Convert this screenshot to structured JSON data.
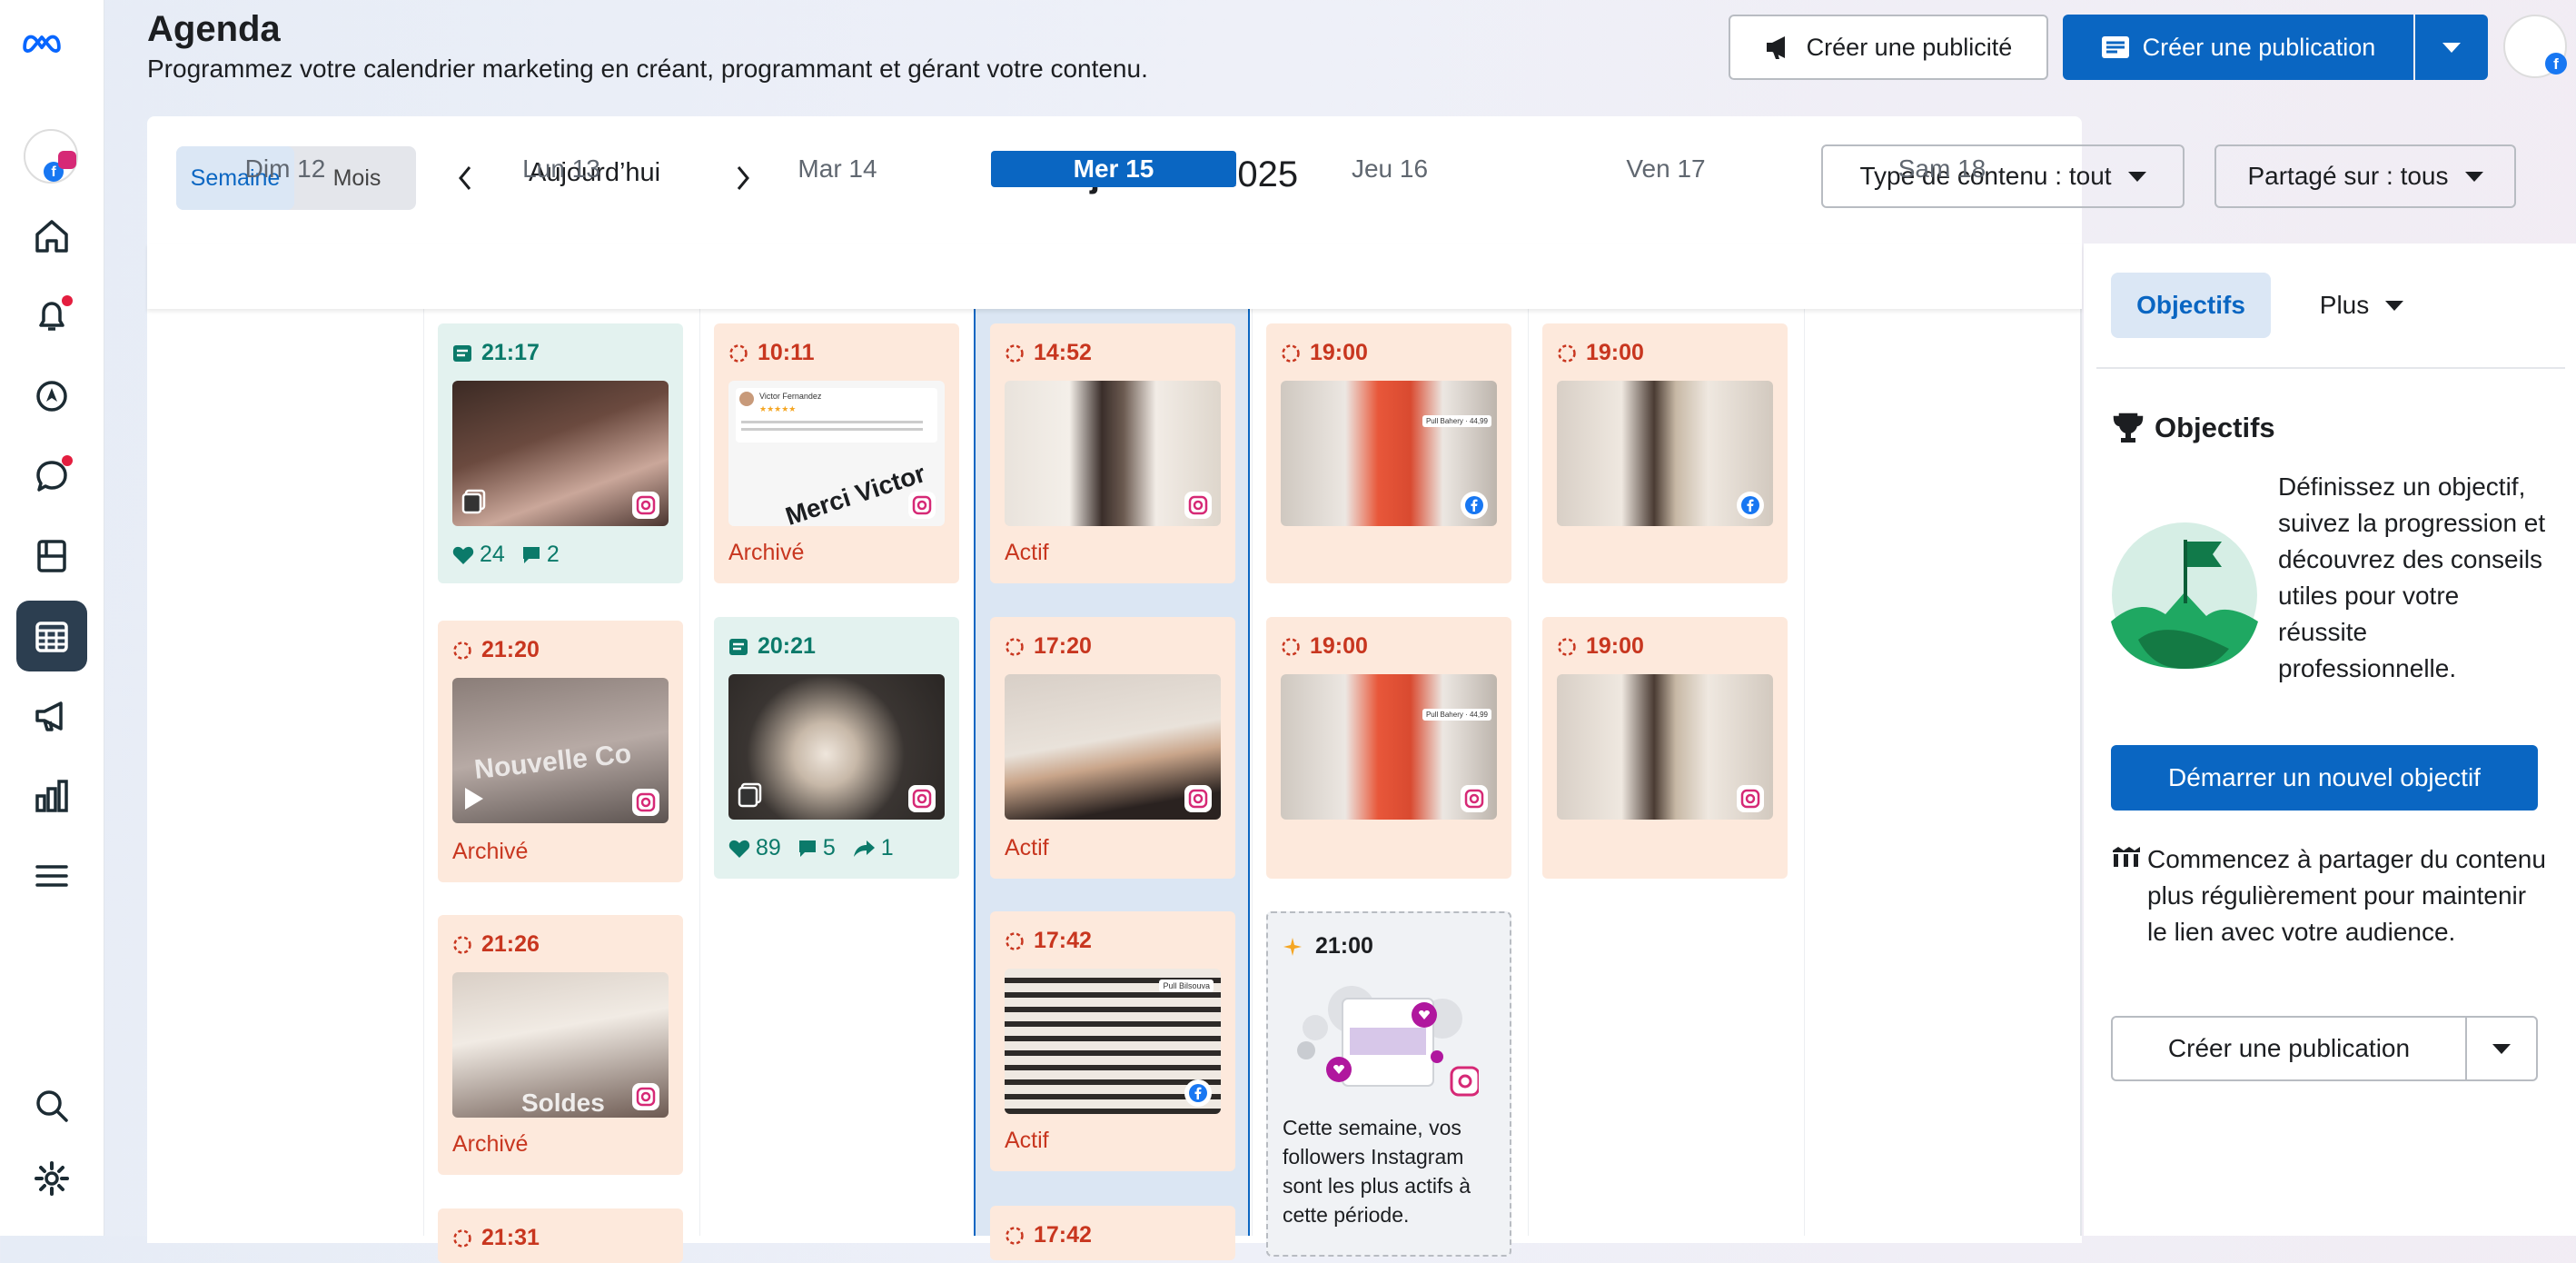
{
  "header": {
    "title": "Agenda",
    "subtitle": "Programmez votre calendrier marketing en créant, programmant et gérant votre contenu.",
    "create_ad_label": "Créer une publicité",
    "create_post_label": "Créer une publication"
  },
  "toolbar": {
    "view_week": "Semaine",
    "view_month": "Mois",
    "today_label": "Aujourd’hui",
    "month_label": "janvier",
    "year_label": "2025",
    "content_type_filter": "Type de contenu : tout",
    "shared_on_filter": "Partagé sur : tous"
  },
  "days": [
    {
      "label": "Dim 12"
    },
    {
      "label": "Lun 13"
    },
    {
      "label": "Mar 14"
    },
    {
      "label": "Mer 15"
    },
    {
      "label": "Jeu 16"
    },
    {
      "label": "Ven 17"
    },
    {
      "label": "Sam 18"
    }
  ],
  "posts": {
    "lun_1": {
      "time": "21:17",
      "likes": "24",
      "comments": "2"
    },
    "lun_2": {
      "time": "21:20",
      "status": "Archivé",
      "overlay": "Nouvelle Co"
    },
    "lun_3": {
      "time": "21:26",
      "status": "Archivé",
      "overlay": "Soldes"
    },
    "lun_4": {
      "time": "21:31"
    },
    "mar_1": {
      "time": "10:11",
      "status": "Archivé",
      "overlay": "Merci Victor",
      "review_name": "Victor Fernandez"
    },
    "mar_2": {
      "time": "20:21",
      "likes": "89",
      "comments": "5",
      "shares": "1"
    },
    "mer_1": {
      "time": "14:52",
      "status": "Actif"
    },
    "mer_2": {
      "time": "17:20",
      "status": "Actif"
    },
    "mer_3": {
      "time": "17:42",
      "status": "Actif",
      "sticker": "Pull Bilsouva"
    },
    "mer_4": {
      "time": "17:42"
    },
    "jeu_1": {
      "time": "19:00",
      "sticker": "Pull Bahery · 44,99"
    },
    "jeu_2": {
      "time": "19:00",
      "sticker": "Pull Bahery · 44,99"
    },
    "jeu_tip": {
      "time": "21:00",
      "text": "Cette semaine, vos followers Instagram sont les plus actifs à cette période."
    },
    "ven_1": {
      "time": "19:00"
    },
    "ven_2": {
      "time": "19:00"
    }
  },
  "sidebar": {
    "tab_goals": "Objectifs",
    "tab_more": "Plus",
    "goals_heading": "Objectifs",
    "goals_text": "Définissez un objectif, suivez la progression et découvrez des conseils utiles pour votre réussite professionnelle.",
    "new_goal_button": "Démarrer un nouvel objectif",
    "tip_text": "Commencez à partager du contenu plus régulièrement pour maintenir le lien avec votre audience.",
    "create_post_button": "Créer une publication"
  },
  "colors": {
    "primary": "#0a66c2",
    "published_bg": "#e3f2ef",
    "scheduled_bg": "#fde9dc",
    "status_red": "#c8361f",
    "published_green": "#0b7a6a"
  }
}
